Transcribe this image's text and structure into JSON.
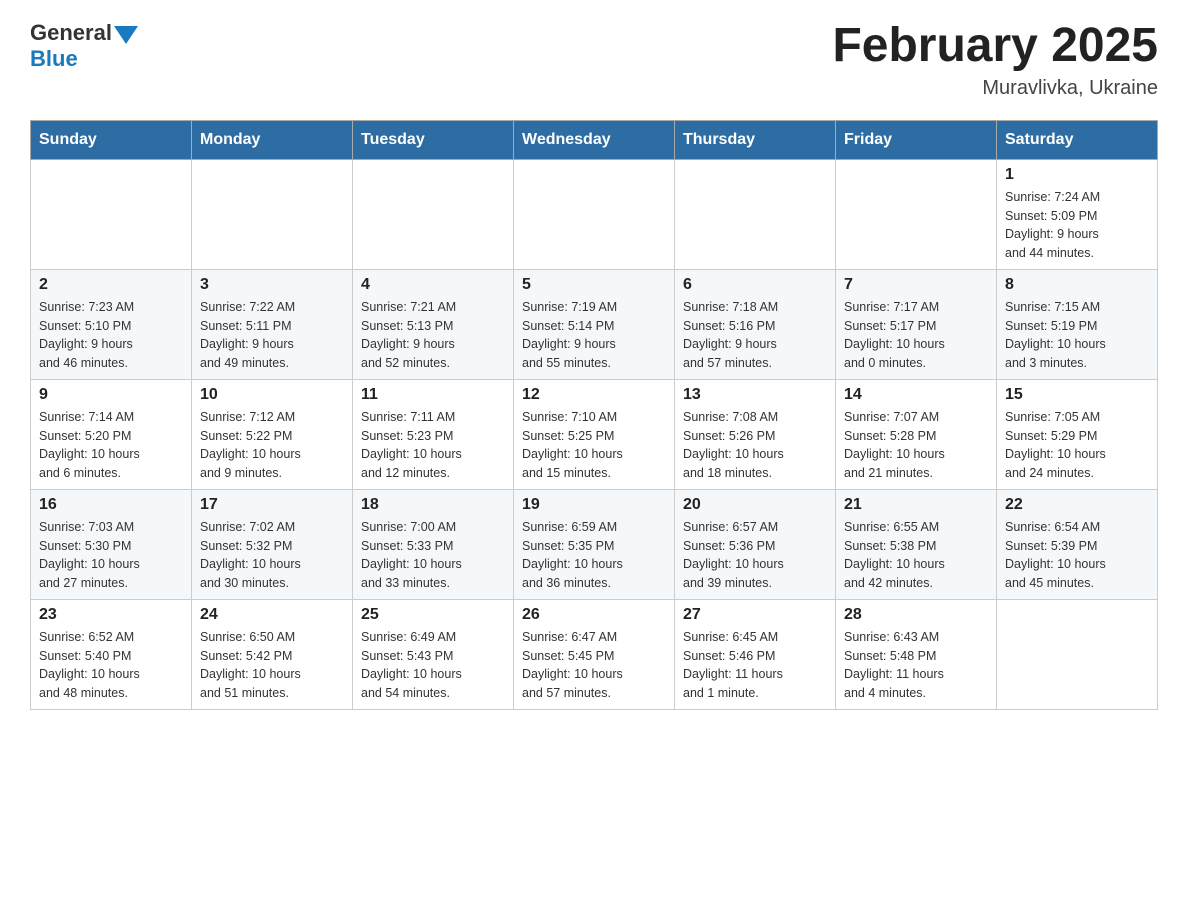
{
  "header": {
    "logo_general": "General",
    "logo_blue": "Blue",
    "title": "February 2025",
    "location": "Muravlivka, Ukraine"
  },
  "days_of_week": [
    "Sunday",
    "Monday",
    "Tuesday",
    "Wednesday",
    "Thursday",
    "Friday",
    "Saturday"
  ],
  "weeks": [
    [
      {
        "day": "",
        "info": ""
      },
      {
        "day": "",
        "info": ""
      },
      {
        "day": "",
        "info": ""
      },
      {
        "day": "",
        "info": ""
      },
      {
        "day": "",
        "info": ""
      },
      {
        "day": "",
        "info": ""
      },
      {
        "day": "1",
        "info": "Sunrise: 7:24 AM\nSunset: 5:09 PM\nDaylight: 9 hours\nand 44 minutes."
      }
    ],
    [
      {
        "day": "2",
        "info": "Sunrise: 7:23 AM\nSunset: 5:10 PM\nDaylight: 9 hours\nand 46 minutes."
      },
      {
        "day": "3",
        "info": "Sunrise: 7:22 AM\nSunset: 5:11 PM\nDaylight: 9 hours\nand 49 minutes."
      },
      {
        "day": "4",
        "info": "Sunrise: 7:21 AM\nSunset: 5:13 PM\nDaylight: 9 hours\nand 52 minutes."
      },
      {
        "day": "5",
        "info": "Sunrise: 7:19 AM\nSunset: 5:14 PM\nDaylight: 9 hours\nand 55 minutes."
      },
      {
        "day": "6",
        "info": "Sunrise: 7:18 AM\nSunset: 5:16 PM\nDaylight: 9 hours\nand 57 minutes."
      },
      {
        "day": "7",
        "info": "Sunrise: 7:17 AM\nSunset: 5:17 PM\nDaylight: 10 hours\nand 0 minutes."
      },
      {
        "day": "8",
        "info": "Sunrise: 7:15 AM\nSunset: 5:19 PM\nDaylight: 10 hours\nand 3 minutes."
      }
    ],
    [
      {
        "day": "9",
        "info": "Sunrise: 7:14 AM\nSunset: 5:20 PM\nDaylight: 10 hours\nand 6 minutes."
      },
      {
        "day": "10",
        "info": "Sunrise: 7:12 AM\nSunset: 5:22 PM\nDaylight: 10 hours\nand 9 minutes."
      },
      {
        "day": "11",
        "info": "Sunrise: 7:11 AM\nSunset: 5:23 PM\nDaylight: 10 hours\nand 12 minutes."
      },
      {
        "day": "12",
        "info": "Sunrise: 7:10 AM\nSunset: 5:25 PM\nDaylight: 10 hours\nand 15 minutes."
      },
      {
        "day": "13",
        "info": "Sunrise: 7:08 AM\nSunset: 5:26 PM\nDaylight: 10 hours\nand 18 minutes."
      },
      {
        "day": "14",
        "info": "Sunrise: 7:07 AM\nSunset: 5:28 PM\nDaylight: 10 hours\nand 21 minutes."
      },
      {
        "day": "15",
        "info": "Sunrise: 7:05 AM\nSunset: 5:29 PM\nDaylight: 10 hours\nand 24 minutes."
      }
    ],
    [
      {
        "day": "16",
        "info": "Sunrise: 7:03 AM\nSunset: 5:30 PM\nDaylight: 10 hours\nand 27 minutes."
      },
      {
        "day": "17",
        "info": "Sunrise: 7:02 AM\nSunset: 5:32 PM\nDaylight: 10 hours\nand 30 minutes."
      },
      {
        "day": "18",
        "info": "Sunrise: 7:00 AM\nSunset: 5:33 PM\nDaylight: 10 hours\nand 33 minutes."
      },
      {
        "day": "19",
        "info": "Sunrise: 6:59 AM\nSunset: 5:35 PM\nDaylight: 10 hours\nand 36 minutes."
      },
      {
        "day": "20",
        "info": "Sunrise: 6:57 AM\nSunset: 5:36 PM\nDaylight: 10 hours\nand 39 minutes."
      },
      {
        "day": "21",
        "info": "Sunrise: 6:55 AM\nSunset: 5:38 PM\nDaylight: 10 hours\nand 42 minutes."
      },
      {
        "day": "22",
        "info": "Sunrise: 6:54 AM\nSunset: 5:39 PM\nDaylight: 10 hours\nand 45 minutes."
      }
    ],
    [
      {
        "day": "23",
        "info": "Sunrise: 6:52 AM\nSunset: 5:40 PM\nDaylight: 10 hours\nand 48 minutes."
      },
      {
        "day": "24",
        "info": "Sunrise: 6:50 AM\nSunset: 5:42 PM\nDaylight: 10 hours\nand 51 minutes."
      },
      {
        "day": "25",
        "info": "Sunrise: 6:49 AM\nSunset: 5:43 PM\nDaylight: 10 hours\nand 54 minutes."
      },
      {
        "day": "26",
        "info": "Sunrise: 6:47 AM\nSunset: 5:45 PM\nDaylight: 10 hours\nand 57 minutes."
      },
      {
        "day": "27",
        "info": "Sunrise: 6:45 AM\nSunset: 5:46 PM\nDaylight: 11 hours\nand 1 minute."
      },
      {
        "day": "28",
        "info": "Sunrise: 6:43 AM\nSunset: 5:48 PM\nDaylight: 11 hours\nand 4 minutes."
      },
      {
        "day": "",
        "info": ""
      }
    ]
  ]
}
